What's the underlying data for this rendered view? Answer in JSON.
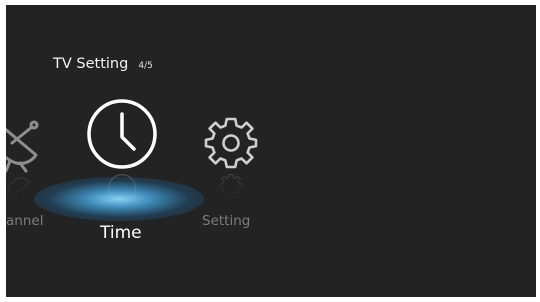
{
  "menu": {
    "title": "TV Setting",
    "page_indicator": "4/5"
  },
  "items": [
    {
      "label": "Channel",
      "visible_label": "annel",
      "icon": "satellite-dish-icon",
      "selected": false
    },
    {
      "label": "Time",
      "visible_label": "Time",
      "icon": "clock-icon",
      "selected": true
    },
    {
      "label": "Setting",
      "visible_label": "Setting",
      "icon": "gear-icon",
      "selected": false
    }
  ],
  "colors": {
    "background": "#232323",
    "active_text": "#ffffff",
    "inactive_text": "#7c7c7c",
    "highlight_glow": "#5ab8ee"
  }
}
